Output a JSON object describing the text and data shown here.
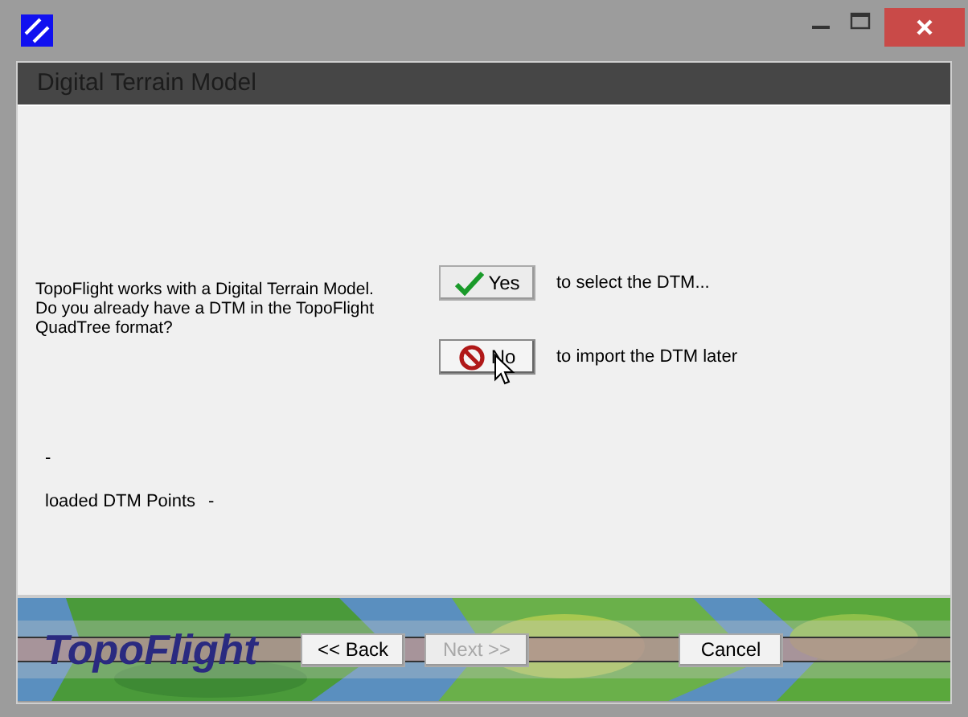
{
  "header": {
    "title": "Digital Terrain Model"
  },
  "question": "TopoFlight works with a Digital Terrain Model. Do you already have a DTM in the TopoFlight QuadTree format?",
  "options": [
    {
      "kind": "yes",
      "label": "Yes",
      "description": "to select the DTM...",
      "hovered": false
    },
    {
      "kind": "no",
      "label": "No",
      "description": "to import the DTM later",
      "hovered": true
    }
  ],
  "status": {
    "line_1": "-",
    "points_label": "loaded DTM Points",
    "points_value": "-"
  },
  "footer": {
    "logo": "TopoFlight",
    "buttons": [
      {
        "label": "<< Back",
        "disabled": false
      },
      {
        "label": "Next >>",
        "disabled": true
      },
      {
        "label": "Cancel",
        "disabled": false
      }
    ]
  }
}
